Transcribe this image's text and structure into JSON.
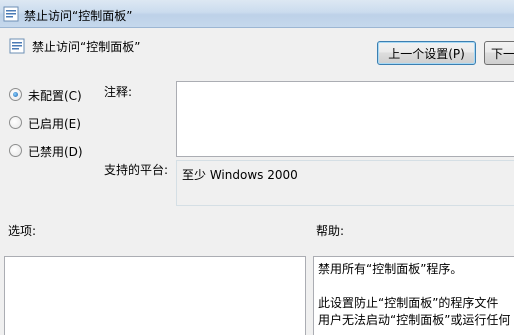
{
  "window": {
    "title": "禁止访问“控制面板”",
    "icon": "policy-setting-icon"
  },
  "header": {
    "setting_name": "禁止访问“控制面板”",
    "icon": "policy-setting-icon"
  },
  "nav": {
    "previous_label": "上一个设置(P)",
    "next_label": "下一"
  },
  "state": {
    "options": [
      {
        "label": "未配置(C)",
        "selected": true
      },
      {
        "label": "已启用(E)",
        "selected": false
      },
      {
        "label": "已禁用(D)",
        "selected": false
      }
    ]
  },
  "comment": {
    "label": "注释:",
    "value": ""
  },
  "supported": {
    "label": "支持的平台:",
    "value": "至少 Windows 2000"
  },
  "options_section": {
    "label": "选项:"
  },
  "help_section": {
    "label": "帮助:",
    "lines": [
      "禁用所有“控制面板”程序。",
      "此设置防止“控制面板”的程序文件",
      "用户无法启动“控制面板”或运行任何"
    ]
  },
  "colors": {
    "titlebar": "#c5d8ec",
    "window_bg": "#f0f0f0",
    "radio_dot": "#1b5fa8"
  }
}
